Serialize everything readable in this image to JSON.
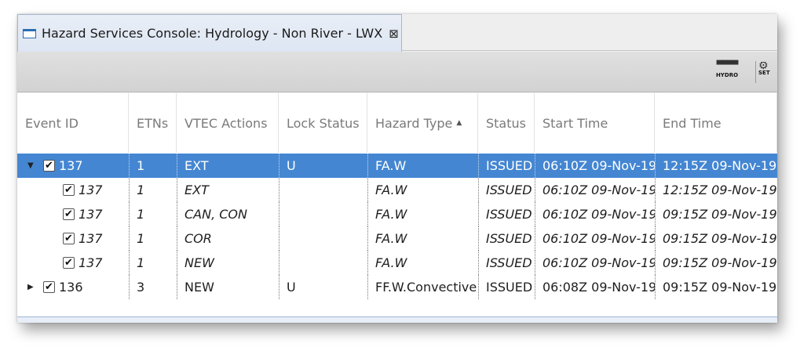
{
  "tab": {
    "title": "Hazard Services Console: Hydrology - Non River - LWX",
    "close_glyph": "⊠"
  },
  "toolbar": {
    "hydro_label": "HYDRO",
    "hydro_icon": "hydro-icon",
    "setup_label": "SET",
    "setup_icon": "gear-icon"
  },
  "columns": [
    "Event ID",
    "ETNs",
    "VTEC Actions",
    "Lock Status",
    "Hazard Type",
    "Status",
    "Start Time",
    "End Time"
  ],
  "sort": {
    "column": "Hazard Type",
    "direction": "ascending",
    "glyph": "▲"
  },
  "rows": [
    {
      "expanded": true,
      "selected": true,
      "child": false,
      "checked": true,
      "event_id": "137",
      "etns": "1",
      "vtec": "EXT",
      "lock": "U",
      "hazard": "FA.W",
      "status": "ISSUED",
      "start": "06:10Z 09-Nov-19",
      "end": "12:15Z 09-Nov-19",
      "twisty": "▼"
    },
    {
      "selected": false,
      "child": true,
      "checked": true,
      "event_id": "137",
      "etns": "1",
      "vtec": "EXT",
      "lock": "",
      "hazard": "FA.W",
      "status": "ISSUED",
      "start": "06:10Z 09-Nov-19",
      "end": "12:15Z 09-Nov-19"
    },
    {
      "selected": false,
      "child": true,
      "checked": true,
      "event_id": "137",
      "etns": "1",
      "vtec": "CAN, CON",
      "lock": "",
      "hazard": "FA.W",
      "status": "ISSUED",
      "start": "06:10Z 09-Nov-19",
      "end": "09:15Z 09-Nov-19"
    },
    {
      "selected": false,
      "child": true,
      "checked": true,
      "event_id": "137",
      "etns": "1",
      "vtec": "COR",
      "lock": "",
      "hazard": "FA.W",
      "status": "ISSUED",
      "start": "06:10Z 09-Nov-19",
      "end": "09:15Z 09-Nov-19"
    },
    {
      "selected": false,
      "child": true,
      "checked": true,
      "event_id": "137",
      "etns": "1",
      "vtec": "NEW",
      "lock": "",
      "hazard": "FA.W",
      "status": "ISSUED",
      "start": "06:10Z 09-Nov-19",
      "end": "09:15Z 09-Nov-19"
    },
    {
      "expanded": false,
      "selected": false,
      "child": false,
      "checked": true,
      "event_id": "136",
      "etns": "3",
      "vtec": "NEW",
      "lock": "U",
      "hazard": "FF.W.Convective",
      "status": "ISSUED",
      "start": "06:08Z 09-Nov-19",
      "end": "09:15Z 09-Nov-19",
      "twisty": "▶"
    }
  ],
  "colors": {
    "selection": "#4486d2",
    "tab_border": "#a7b7cf"
  }
}
